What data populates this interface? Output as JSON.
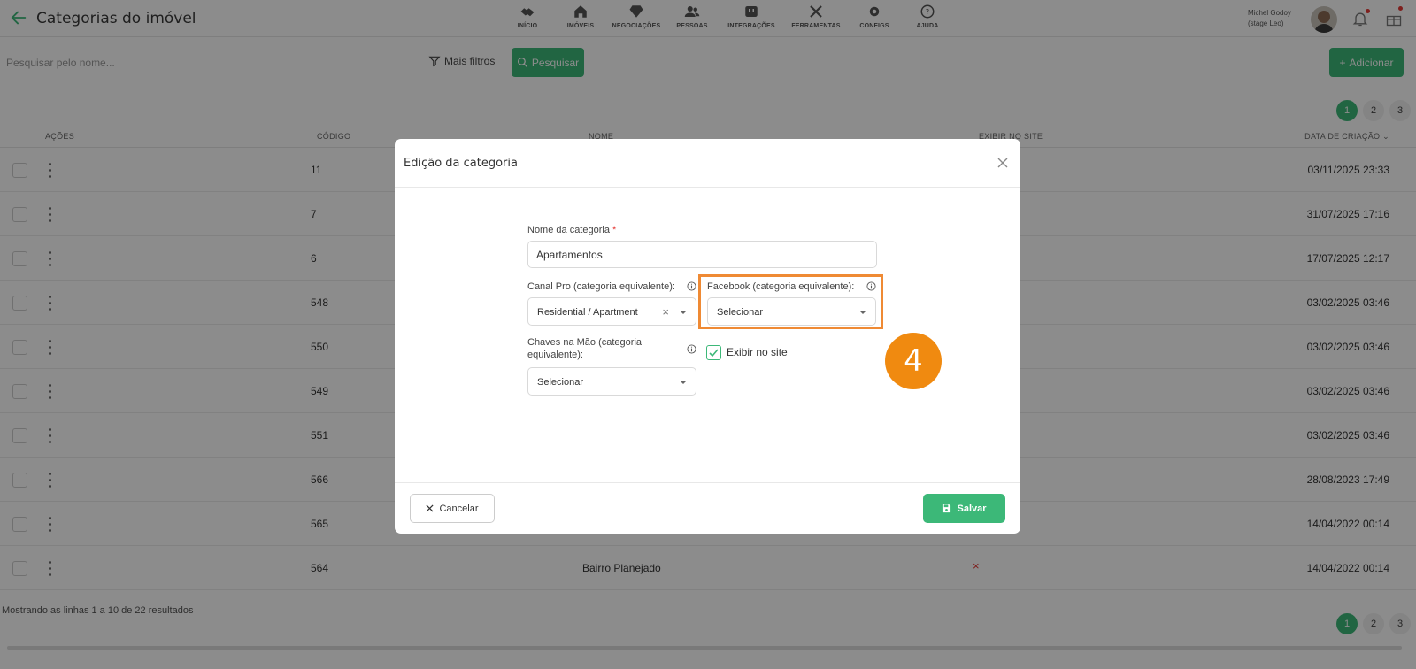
{
  "header": {
    "title": "Categorias do imóvel",
    "nav": [
      {
        "label": "INÍCIO",
        "icon": "handshake-icon"
      },
      {
        "label": "IMÓVEIS",
        "icon": "home-icon"
      },
      {
        "label": "NEGOCIAÇÕES",
        "icon": "diamond-icon"
      },
      {
        "label": "PESSOAS",
        "icon": "people-icon"
      },
      {
        "label": "INTEGRAÇÕES",
        "icon": "plug-icon"
      },
      {
        "label": "FERRAMENTAS",
        "icon": "tools-icon"
      },
      {
        "label": "CONFIGS",
        "icon": "gear-icon"
      },
      {
        "label": "AJUDA",
        "icon": "help-icon"
      }
    ],
    "user_name": "Michel Godoy",
    "user_org": "(stage Leo)"
  },
  "toolbar": {
    "search_placeholder": "Pesquisar pelo nome...",
    "filters_label": "Mais filtros",
    "search_label": "Pesquisar",
    "add_label": "Adicionar"
  },
  "pagination": [
    "1",
    "2",
    "3"
  ],
  "table": {
    "headers": {
      "actions": "AÇÕES",
      "code": "CÓDIGO",
      "name": "NOME",
      "site": "EXIBIR NO SITE",
      "date": "DATA DE CRIAÇÃO"
    },
    "rows": [
      {
        "code": "11",
        "name": "",
        "site": "",
        "date": "03/11/2025 23:33"
      },
      {
        "code": "7",
        "name": "",
        "site": "",
        "date": "31/07/2025 17:16"
      },
      {
        "code": "6",
        "name": "",
        "site": "",
        "date": "17/07/2025 12:17"
      },
      {
        "code": "548",
        "name": "",
        "site": "",
        "date": "03/02/2025 03:46"
      },
      {
        "code": "550",
        "name": "",
        "site": "",
        "date": "03/02/2025 03:46"
      },
      {
        "code": "549",
        "name": "",
        "site": "",
        "date": "03/02/2025 03:46"
      },
      {
        "code": "551",
        "name": "",
        "site": "",
        "date": "03/02/2025 03:46"
      },
      {
        "code": "566",
        "name": "",
        "site": "",
        "date": "28/08/2023 17:49"
      },
      {
        "code": "565",
        "name": "",
        "site": "",
        "date": "14/04/2022 00:14"
      },
      {
        "code": "564",
        "name": "Bairro Planejado",
        "site": "×",
        "date": "14/04/2022 00:14"
      }
    ]
  },
  "footer_text": "Mostrando as linhas 1 a 10 de 22 resultados",
  "modal": {
    "title": "Edição da categoria",
    "name_label": "Nome da categoria",
    "required_mark": "*",
    "name_value": "Apartamentos",
    "canal_label": "Canal Pro (categoria equivalente):",
    "canal_value": "Residential / Apartment",
    "facebook_label": "Facebook (categoria equivalente):",
    "facebook_value": "Selecionar",
    "chaves_label_1": "Chaves na Mão (categoria",
    "chaves_label_2": "equivalente):",
    "chaves_value": "Selecionar",
    "site_label": "Exibir no site",
    "site_checked": true,
    "cancel_label": "Cancelar",
    "save_label": "Salvar"
  },
  "step_badge": "4",
  "colors": {
    "accent": "#3cb878",
    "highlight": "#ef8a34",
    "badge": "#f08a10"
  }
}
